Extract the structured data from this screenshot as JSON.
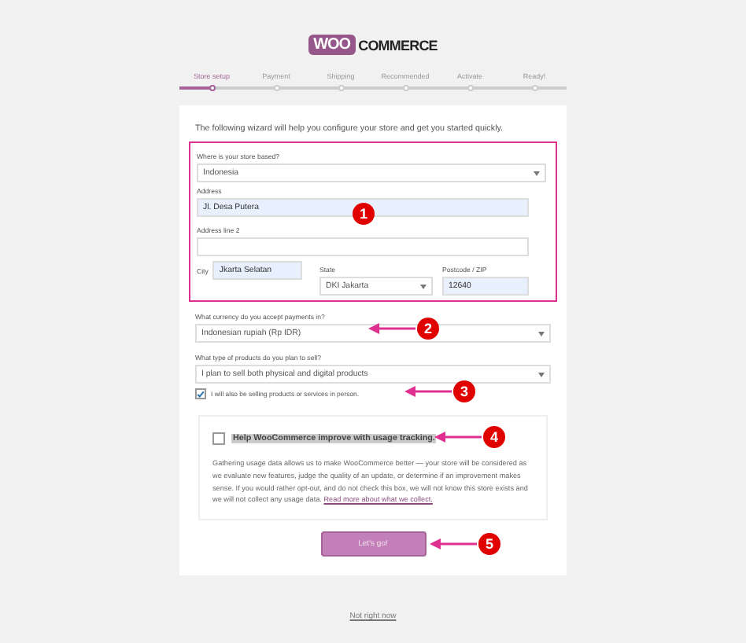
{
  "logo": {
    "badge": "WOO",
    "word": "COMMERCE"
  },
  "steps": [
    {
      "label": "Store setup",
      "selected": true
    },
    {
      "label": "Payment",
      "selected": false
    },
    {
      "label": "Shipping",
      "selected": false
    },
    {
      "label": "Recommended",
      "selected": false
    },
    {
      "label": "Activate",
      "selected": false
    },
    {
      "label": "Ready!",
      "selected": false
    }
  ],
  "intro": "The following wizard will help you configure your store and get you started quickly.",
  "location": {
    "highlighted": true,
    "country_label": "Where is your store based?",
    "country": "Indonesia",
    "address_label": "Address",
    "address": "Jl. Desa Putera",
    "address2_label": "Address line 2",
    "city_label": "City",
    "city": "Jkarta Selatan",
    "state_label": "State",
    "state": "DKI Jakarta",
    "postcode_label": "Postcode / ZIP",
    "postcode": "12640"
  },
  "currency": {
    "label": "What currency do you accept payments in?",
    "value": "Indonesian rupiah (Rp IDR)"
  },
  "products": {
    "label": "What type of products do you plan to sell?",
    "value": "I plan to sell both physical and digital products",
    "in_person_label": "I will also be selling products or services in person.",
    "in_person_checked": true
  },
  "tracking": {
    "label": "Help WooCommerce improve with usage tracking.",
    "checked": false,
    "text": "Gathering usage data allows us to make WooCommerce better — your store will be considered as we evaluate new features, judge the quality of an update, or determine if an improvement makes sense. If you would rather opt-out, and do not check this box, we will not know this store exists and we will not collect any usage data.",
    "link": "Read more about what we collect."
  },
  "submit": "Let's go!",
  "skip": "Not right now",
  "markers": [
    {
      "number": "1",
      "arrow": false
    },
    {
      "number": "2",
      "arrow": true
    },
    {
      "number": "3",
      "arrow": true
    },
    {
      "number": "4",
      "arrow": true
    },
    {
      "number": "5",
      "arrow": true
    }
  ]
}
